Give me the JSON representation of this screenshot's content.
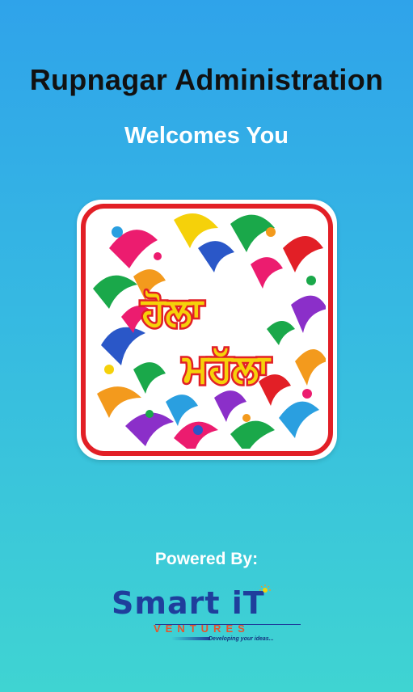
{
  "splash": {
    "title": "Rupnagar Administration",
    "subtitle": "Welcomes You"
  },
  "logo": {
    "text_line1": "ਹੋਲਾ",
    "text_line2": "ਮਹੱਲਾ",
    "border_color": "#e21f26",
    "text_color": "#f5d10a"
  },
  "footer": {
    "powered_by": "Powered By:",
    "brand_name": "Smart iT",
    "brand_sub": "VENTURES",
    "brand_tagline": "Developing your ideas...",
    "brand_color": "#1f3e9c",
    "accent_color": "#e7532a"
  }
}
